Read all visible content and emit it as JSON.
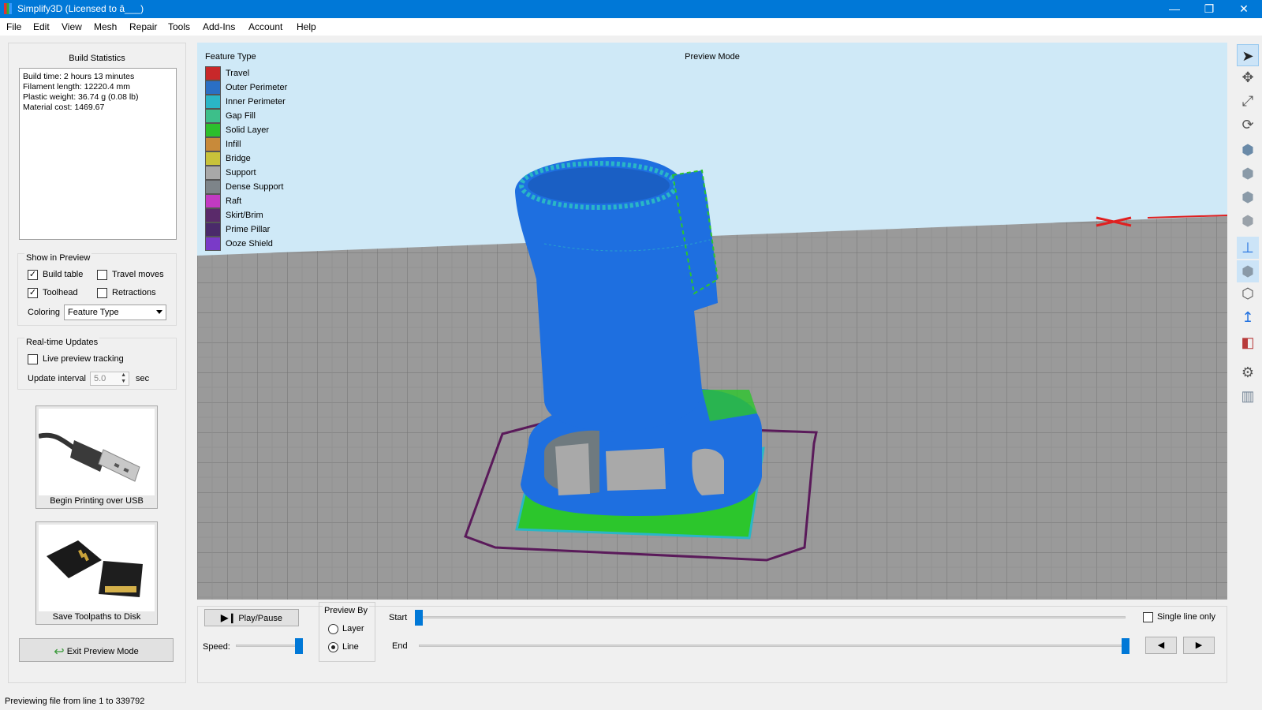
{
  "window": {
    "title": "Simplify3D (Licensed to â___)",
    "min": "—",
    "max": "❐",
    "close": "✕"
  },
  "menu": [
    "File",
    "Edit",
    "View",
    "Mesh",
    "Repair",
    "Tools",
    "Add-Ins",
    "Account",
    "Help"
  ],
  "build_stats": {
    "title": "Build Statistics",
    "lines": [
      "Build time: 2 hours 13 minutes",
      "Filament length: 12220.4 mm",
      "Plastic weight: 36.74 g (0.08 lb)",
      "Material cost: 1469.67"
    ]
  },
  "show_in_preview": {
    "title": "Show in Preview",
    "build_table": "Build table",
    "travel_moves": "Travel moves",
    "toolhead": "Toolhead",
    "retractions": "Retractions",
    "coloring_label": "Coloring",
    "coloring_value": "Feature Type"
  },
  "realtime": {
    "title": "Real-time Updates",
    "live_tracking": "Live preview tracking",
    "interval_label": "Update interval",
    "interval_value": "5.0",
    "interval_unit": "sec"
  },
  "usb_tile": {
    "label": "Begin Printing over USB"
  },
  "sd_tile": {
    "label": "Save Toolpaths to Disk"
  },
  "exit_button": "Exit Preview Mode",
  "viewport": {
    "legend_title": "Feature Type",
    "mode_label": "Preview Mode",
    "legend": [
      {
        "name": "Travel",
        "color": "#c8282a"
      },
      {
        "name": "Outer Perimeter",
        "color": "#2a6fc4"
      },
      {
        "name": "Inner Perimeter",
        "color": "#2ab6c6"
      },
      {
        "name": "Gap Fill",
        "color": "#3dbf8a"
      },
      {
        "name": "Solid Layer",
        "color": "#2cbf2c"
      },
      {
        "name": "Infill",
        "color": "#c88a3a"
      },
      {
        "name": "Bridge",
        "color": "#c8c23a"
      },
      {
        "name": "Support",
        "color": "#a8a8a8"
      },
      {
        "name": "Dense Support",
        "color": "#7d8489"
      },
      {
        "name": "Raft",
        "color": "#c23ac2"
      },
      {
        "name": "Skirt/Brim",
        "color": "#5a2a6a"
      },
      {
        "name": "Prime Pillar",
        "color": "#4a2a6a"
      },
      {
        "name": "Ooze Shield",
        "color": "#7a3ac8"
      }
    ]
  },
  "playback": {
    "play_label": "Play/Pause",
    "speed_label": "Speed:",
    "preview_by": "Preview By",
    "layer": "Layer",
    "line": "Line",
    "start": "Start",
    "end": "End",
    "single_line": "Single line only",
    "start_position": 0,
    "end_position": 1,
    "speed_level": 1
  },
  "status": "Previewing file from line 1 to 339792"
}
